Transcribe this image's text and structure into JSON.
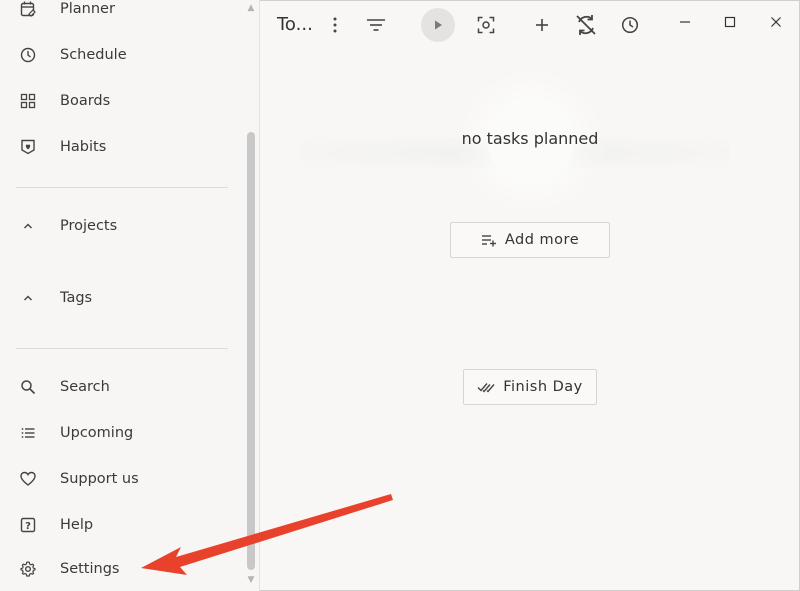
{
  "sidebar": {
    "items": [
      {
        "label": "Planner",
        "icon": "planner-icon"
      },
      {
        "label": "Schedule",
        "icon": "clock-icon"
      },
      {
        "label": "Boards",
        "icon": "boards-icon"
      },
      {
        "label": "Habits",
        "icon": "habits-icon"
      },
      {
        "label": "Projects",
        "icon": "chevron-up-icon"
      },
      {
        "label": "Tags",
        "icon": "chevron-up-icon"
      },
      {
        "label": "Search",
        "icon": "search-icon"
      },
      {
        "label": "Upcoming",
        "icon": "list-icon"
      },
      {
        "label": "Support us",
        "icon": "heart-icon"
      },
      {
        "label": "Help",
        "icon": "help-icon"
      },
      {
        "label": "Settings",
        "icon": "gear-icon"
      }
    ]
  },
  "toolbar": {
    "title": "To..."
  },
  "main": {
    "empty_text": "no tasks planned",
    "add_more_label": "Add more",
    "finish_day_label": "Finish Day"
  },
  "colors": {
    "background": "#f8f7f5",
    "annotation_arrow": "#e8412c"
  }
}
